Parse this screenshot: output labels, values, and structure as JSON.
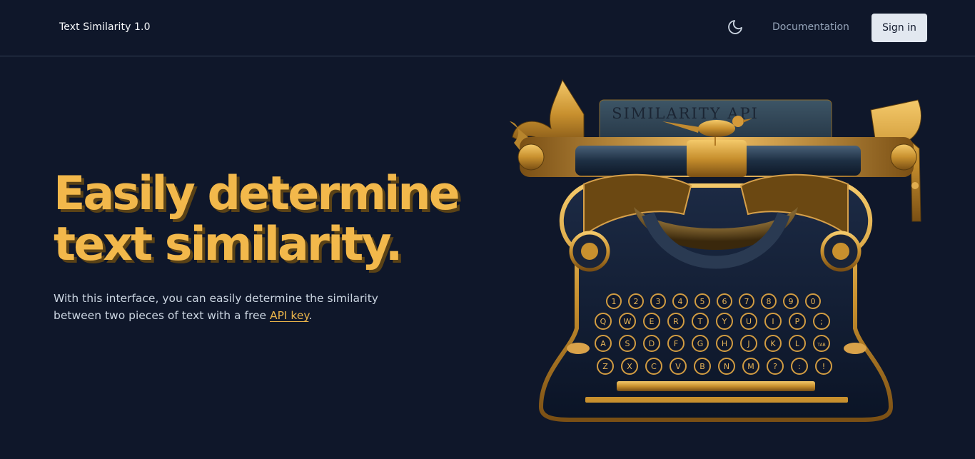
{
  "navbar": {
    "brand": "Text Similarity 1.0",
    "theme_icon": "moon-icon",
    "docs_label": "Documentation",
    "signin_label": "Sign in"
  },
  "hero": {
    "title_line1": "Easily determine",
    "title_line2": "text similarity.",
    "desc_before": "With this interface, you can easily determine the similarity between two pieces of text with a free ",
    "link_label": "API key",
    "desc_after": "."
  },
  "illustration": {
    "paper_text": "SIMILARITY API",
    "row1": [
      "1",
      "2",
      "3",
      "4",
      "5",
      "6",
      "7",
      "8",
      "9",
      "0"
    ],
    "row2": [
      "Q",
      "W",
      "E",
      "R",
      "T",
      "Y",
      "U",
      "I",
      "P",
      ";"
    ],
    "row3": [
      "A",
      "S",
      "D",
      "F",
      "G",
      "H",
      "J",
      "K",
      "L",
      "TAB"
    ],
    "row4": [
      "Z",
      "X",
      "C",
      "V",
      "B",
      "N",
      "M",
      "?",
      ":",
      "!"
    ]
  },
  "colors": {
    "background": "#0f172a",
    "accent": "#f2b84b",
    "gold": "#c8902e",
    "text_muted": "#94a3b8"
  }
}
